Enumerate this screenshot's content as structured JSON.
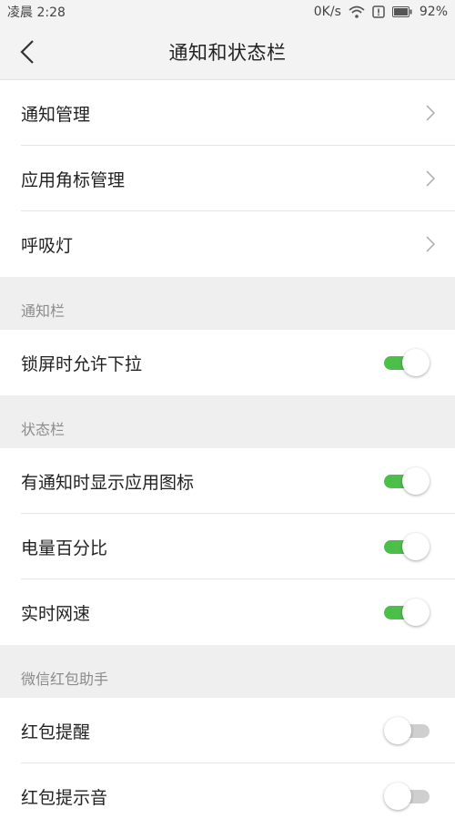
{
  "status_bar": {
    "time": "凌晨 2:28",
    "net_speed": "0K/s",
    "battery": "92%",
    "icons": [
      "wifi-icon",
      "alert-icon",
      "battery-icon"
    ]
  },
  "header": {
    "title": "通知和状态栏",
    "back_icon": "chevron-left-icon"
  },
  "group1": {
    "items": [
      {
        "label": "通知管理",
        "icon": "chevron-right-icon"
      },
      {
        "label": "应用角标管理",
        "icon": "chevron-right-icon"
      },
      {
        "label": "呼吸灯",
        "icon": "chevron-right-icon"
      }
    ]
  },
  "notification_bar": {
    "header": "通知栏",
    "items": [
      {
        "label": "锁屏时允许下拉",
        "enabled": true
      }
    ]
  },
  "status_section": {
    "header": "状态栏",
    "items": [
      {
        "label": "有通知时显示应用图标",
        "enabled": true
      },
      {
        "label": "电量百分比",
        "enabled": true
      },
      {
        "label": "实时网速",
        "enabled": true
      }
    ]
  },
  "red_packet": {
    "header": "微信红包助手",
    "items": [
      {
        "label": "红包提醒",
        "enabled": false
      },
      {
        "label": "红包提示音",
        "enabled": false
      }
    ]
  },
  "colors": {
    "toggle_on": "#4cbf4a",
    "toggle_off": "#cfcfcf",
    "section_bg": "#efefef"
  }
}
